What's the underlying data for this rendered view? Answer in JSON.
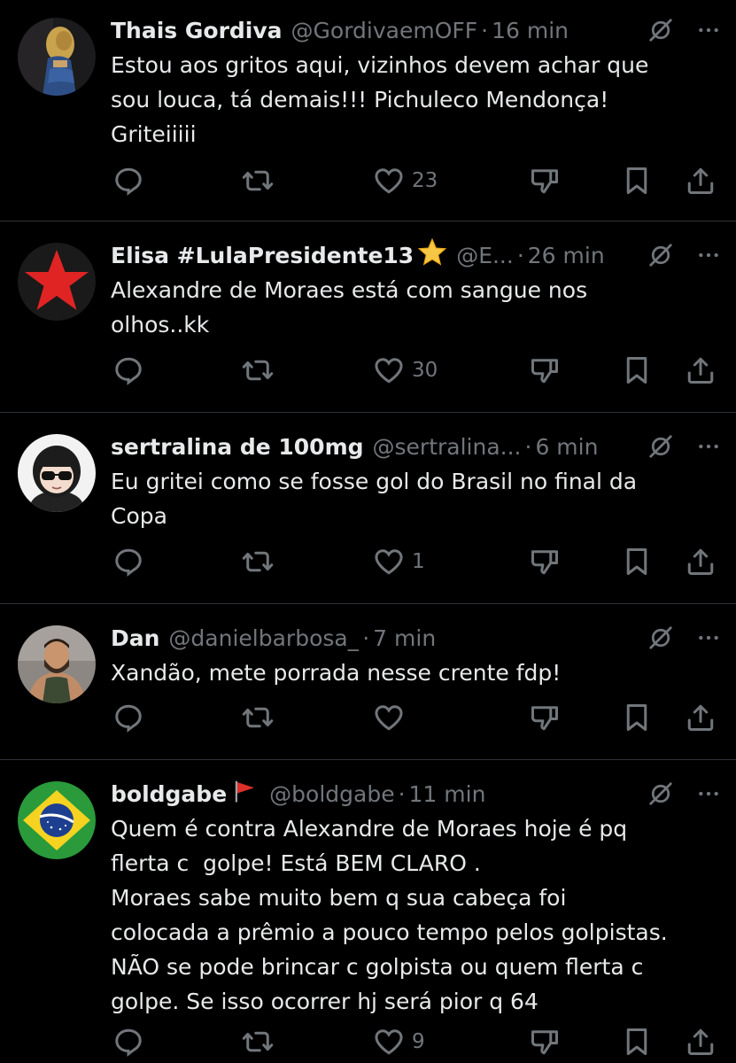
{
  "colors": {
    "background": "#000000",
    "text": "#e7e9ea",
    "muted": "#71767b",
    "divider": "#2f3336"
  },
  "tweets": [
    {
      "name": "Thais Gordiva",
      "handle": "@GordivaemOFF",
      "time": "16 min",
      "text": "Estou aos gritos aqui, vizinhos devem achar que\nsou louca, tá demais!!! Pichuleco Mendonça!\nGriteiiiii",
      "likes": "23",
      "avatar": "photo-woman"
    },
    {
      "name": "Elisa #LulaPresidente13",
      "handle": "@E...",
      "time": "26 min",
      "text": "Alexandre de Moraes está com sangue nos\nolhos..kk",
      "likes": "30",
      "avatar": "red-star"
    },
    {
      "name": "sertralina de 100mg",
      "handle": "@sertralina...",
      "time": "6 min",
      "text": "Eu gritei como se fosse gol do Brasil no final da\nCopa",
      "likes": "1",
      "avatar": "cartoon-girl-sunglasses"
    },
    {
      "name": "Dan",
      "handle": "@danielbarbosa_",
      "time": "7 min",
      "text": "Xandão, mete porrada nesse crente fdp!",
      "likes": "",
      "avatar": "photo-man"
    },
    {
      "name": "boldgabe",
      "handle": "@boldgabe",
      "time": "11 min",
      "text": "Quem é contra Alexandre de Moraes hoje é pq\nflerta c  golpe! Está BEM CLARO .\nMoraes sabe muito bem q sua cabeça foi\ncolocada a prêmio a pouco tempo pelos golpistas.\nNÃO se pode brincar c golpista ou quem flerta c\ngolpe. Se isso ocorrer hj será pior q 64",
      "likes": "9",
      "avatar": "brazil-flag"
    }
  ]
}
